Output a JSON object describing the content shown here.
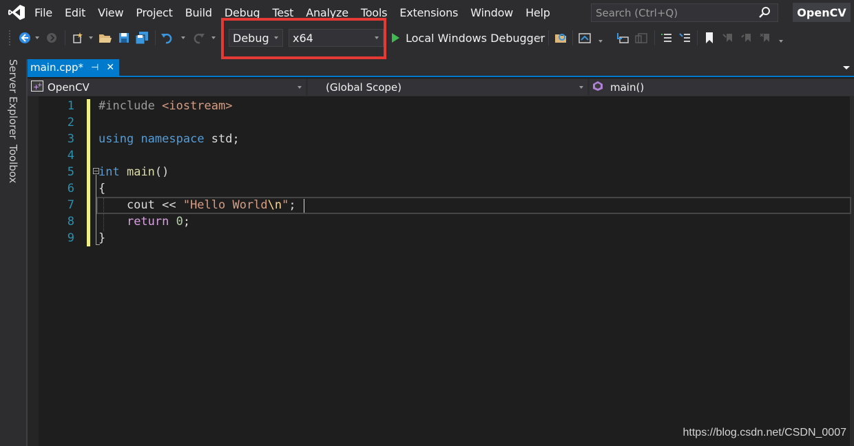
{
  "menubar": {
    "items": [
      "File",
      "Edit",
      "View",
      "Project",
      "Build",
      "Debug",
      "Test",
      "Analyze",
      "Tools",
      "Extensions",
      "Window",
      "Help"
    ],
    "search_placeholder": "Search (Ctrl+Q)",
    "project_name": "OpenCV"
  },
  "toolbar": {
    "configuration": "Debug",
    "platform": "x64",
    "debugger_label": "Local Windows Debugger",
    "highlight_color": "#e53935"
  },
  "sidebar": {
    "tabs": [
      "Server Explorer",
      "Toolbox"
    ]
  },
  "tabs": {
    "active_file": "main.cpp*",
    "pin_glyph": "⊣",
    "close_glyph": "✕"
  },
  "navbar": {
    "project": "OpenCV",
    "scope": "(Global Scope)",
    "member": "main()"
  },
  "editor": {
    "line_numbers": [
      "1",
      "2",
      "3",
      "4",
      "5",
      "6",
      "7",
      "8",
      "9"
    ],
    "lines": [
      [
        {
          "t": "#include ",
          "c": "pre"
        },
        {
          "t": "<iostream>",
          "c": "inc"
        }
      ],
      [],
      [
        {
          "t": "using",
          "c": "kw"
        },
        {
          "t": " ",
          "c": "plain"
        },
        {
          "t": "namespace",
          "c": "kw"
        },
        {
          "t": " std;",
          "c": "plain"
        }
      ],
      [],
      [
        {
          "t": "int",
          "c": "kw"
        },
        {
          "t": " ",
          "c": "plain"
        },
        {
          "t": "main",
          "c": "fn"
        },
        {
          "t": "()",
          "c": "plain"
        }
      ],
      [
        {
          "t": "{",
          "c": "plain"
        }
      ],
      [
        {
          "t": "    cout << ",
          "c": "plain"
        },
        {
          "t": "\"Hello World",
          "c": "str"
        },
        {
          "t": "\\n",
          "c": "esc"
        },
        {
          "t": "\"",
          "c": "str"
        },
        {
          "t": ";",
          "c": "plain"
        }
      ],
      [
        {
          "t": "    ",
          "c": "plain"
        },
        {
          "t": "return",
          "c": "ctl"
        },
        {
          "t": " ",
          "c": "plain"
        },
        {
          "t": "0",
          "c": "num"
        },
        {
          "t": ";",
          "c": "plain"
        }
      ],
      [
        {
          "t": "}",
          "c": "plain"
        }
      ]
    ]
  },
  "watermark": "https://blog.csdn.net/CSDN_0007",
  "colors": {
    "accent": "#007acc",
    "change_marker": "#efef85",
    "line_number": "#2b91af"
  },
  "icons": [
    "vs-logo-icon",
    "search-icon",
    "back-icon",
    "forward-icon",
    "new-project-icon",
    "open-folder-icon",
    "save-icon",
    "save-all-icon",
    "undo-icon",
    "redo-icon",
    "start-debug-icon",
    "find-in-files-icon",
    "bookmark-icon",
    "comment-icon",
    "uncomment-icon",
    "cpp-project-icon",
    "method-icon"
  ]
}
